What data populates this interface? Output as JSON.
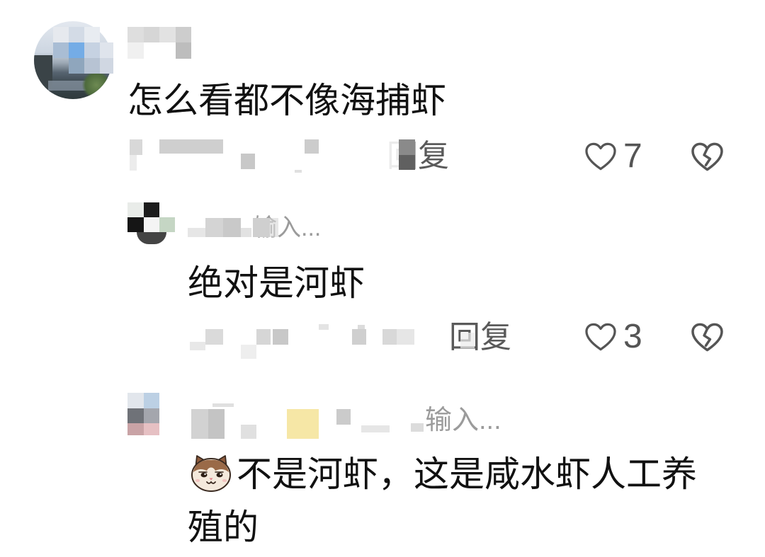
{
  "comments": [
    {
      "text": "怎么看都不像海捕虾",
      "reply_label": "回复",
      "like_count": "7",
      "like_icon": "heart-outline-icon",
      "dislike_icon": "broken-heart-icon"
    },
    {
      "name_suffix": "输入...",
      "text": "绝对是河虾",
      "reply_label": "回复",
      "like_count": "3",
      "like_icon": "heart-outline-icon",
      "dislike_icon": "broken-heart-icon"
    },
    {
      "name_suffix": "输入...",
      "emoji": "cat-face-emoji",
      "text": "不是河虾，这是咸水虾人工养殖的"
    }
  ],
  "colors": {
    "text": "#111111",
    "meta": "#5a5a5a",
    "muted": "#9b9b9b",
    "icon": "#555555"
  }
}
